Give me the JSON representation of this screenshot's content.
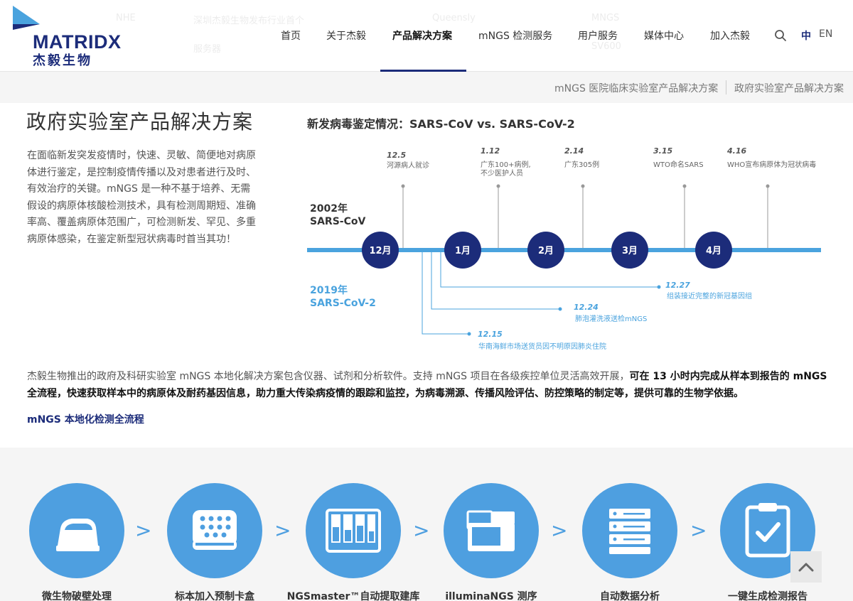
{
  "header": {
    "logo_text": "MATRIDX",
    "logo_cn": "杰毅生物",
    "nav": [
      {
        "label": "首页"
      },
      {
        "label": "关于杰毅"
      },
      {
        "label": "产品解决方案"
      },
      {
        "label": "mNGS 检测服务"
      },
      {
        "label": "用户服务"
      },
      {
        "label": "媒体中心"
      },
      {
        "label": "加入杰毅"
      }
    ],
    "lang_zh": "中",
    "lang_en": "EN",
    "ghost_text": [
      "NHE",
      "深圳杰毅生物发布行业首个",
      "Queensly",
      "MNGS",
      "服务器",
      "SV600"
    ]
  },
  "subnav": {
    "tabs": [
      "mNGS 医院临床实验室产品解决方案",
      "政府实验室产品解决方案"
    ]
  },
  "main": {
    "title": "政府实验室产品解决方案",
    "intro": "在面临新发突发疫情时，快速、灵敏、简便地对病原体进行鉴定，是控制疫情传播以及对患者进行及时、有效治疗的关键。mNGS 是一种不基于培养、无需假设的病原体核酸检测技术，具有检测周期短、准确率高、覆盖病原体范围广，可检测新发、罕见、多重病原体感染，在鉴定新型冠状病毒时首当其功！",
    "chart_title": "新发病毒鉴定情况：SARS-CoV vs. SARS-CoV-2",
    "body_normal": "杰毅生物推出的政府及科研实验室 mNGS 本地化解决方案包含仪器、试剂和分析软件。支持 mNGS 项目在各级疾控单位灵活高效开展，",
    "body_bold": "可在 13 小时内完成从样本到报告的 mNGS 全流程，快速获取样本中的病原体及耐药基因信息，助力重大传染病疫情的跟踪和监控，为病毒溯源、传播风险评估、防控策略的制定等，提供可靠的生物学依据。",
    "section_link": "mNGS 本地化检测全流程"
  },
  "timeline": {
    "label_2002_year": "2002年",
    "label_2002_virus": "SARS-CoV",
    "label_2019_year": "2019年",
    "label_2019_virus": "SARS-CoV-2",
    "months": [
      "12月",
      "1月",
      "2月",
      "3月",
      "4月"
    ],
    "events_2002": [
      {
        "date": "12.5",
        "desc": [
          "河源病人就诊"
        ]
      },
      {
        "date": "1.12",
        "desc": [
          "广东100+病例,",
          "不少医护人员"
        ]
      },
      {
        "date": "2.14",
        "desc": [
          "广东305例"
        ]
      },
      {
        "date": "3.15",
        "desc": [
          "WTO命名SARS"
        ]
      },
      {
        "date": "4.16",
        "desc": [
          "WHO宣布病原体为冠状病毒"
        ]
      }
    ],
    "events_2019": [
      {
        "date": "12.27",
        "desc": "组装接近完整的新冠基因组"
      },
      {
        "date": "12.24",
        "desc": "肺泡灌洗液送检mNGS"
      },
      {
        "date": "12.15",
        "desc": "华南海鲜市场送货员因不明原因肺炎住院"
      }
    ],
    "colors": {
      "navy": "#1c2c7a",
      "blue": "#4aa3de",
      "gray": "#999999"
    }
  },
  "workflow": {
    "steps": [
      {
        "label": "微生物破壁处理",
        "icon": "centrifuge-icon"
      },
      {
        "label": "标本加入预制卡盒",
        "icon": "cartridge-icon"
      },
      {
        "label": "NGSmaster™自动提取建库",
        "icon": "library-prep-icon"
      },
      {
        "label": "illuminaNGS 测序",
        "icon": "sequencer-icon"
      },
      {
        "label": "自动数据分析",
        "icon": "server-icon"
      },
      {
        "label": "一键生成检测报告",
        "icon": "clipboard-check-icon"
      }
    ],
    "arrow": ">"
  }
}
